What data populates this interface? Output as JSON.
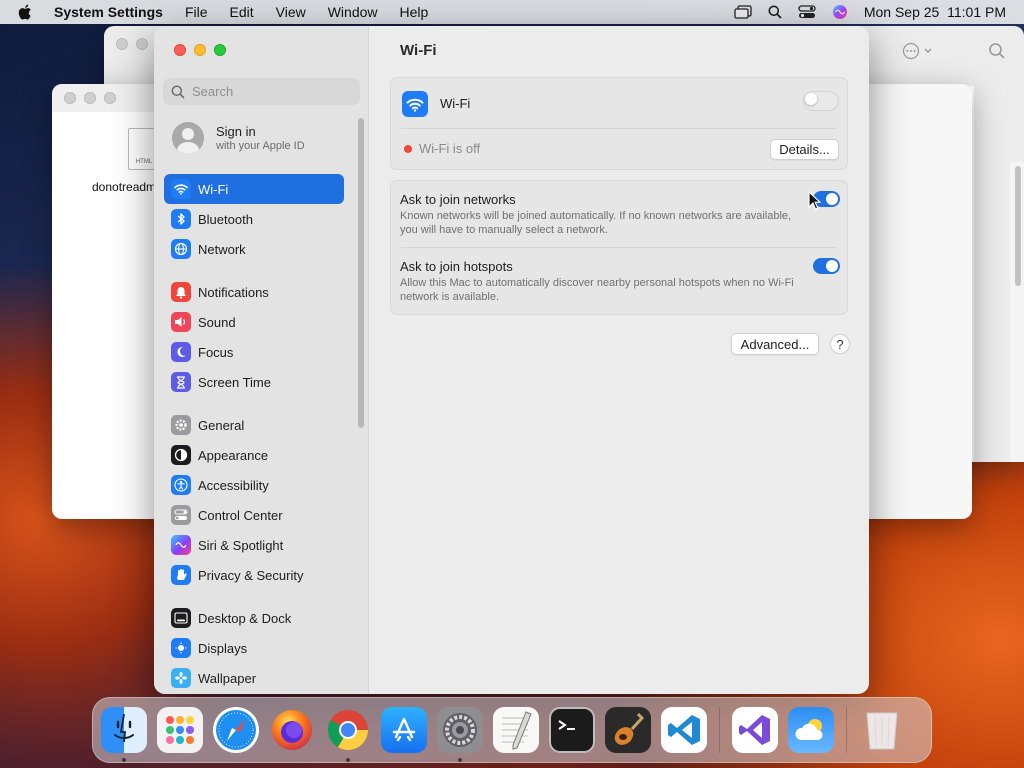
{
  "menubar": {
    "app_name": "System Settings",
    "menus": [
      "File",
      "Edit",
      "View",
      "Window",
      "Help"
    ],
    "clock": "Mon Sep 25  11:01 PM"
  },
  "background_window": {
    "file_label": "donotreadme",
    "file_type": "HTML"
  },
  "sidebar": {
    "search_placeholder": "Search",
    "signin_title": "Sign in",
    "signin_subtitle": "with your Apple ID",
    "groups": [
      [
        {
          "label": "Wi-Fi",
          "icon": "wifi-icon",
          "color": "#1f7cf5",
          "active": true
        },
        {
          "label": "Bluetooth",
          "icon": "bluetooth-icon",
          "color": "#1f7cf5"
        },
        {
          "label": "Network",
          "icon": "globe-icon",
          "color": "#1f7cf5"
        }
      ],
      [
        {
          "label": "Notifications",
          "icon": "bell-icon",
          "color": "#f0463c"
        },
        {
          "label": "Sound",
          "icon": "speaker-icon",
          "color": "#f0465a"
        },
        {
          "label": "Focus",
          "icon": "moon-icon",
          "color": "#5e5ce6"
        },
        {
          "label": "Screen Time",
          "icon": "hourglass-icon",
          "color": "#5e5ce6"
        }
      ],
      [
        {
          "label": "General",
          "icon": "gear-icon",
          "color": "#9a9a9f"
        },
        {
          "label": "Appearance",
          "icon": "appearance-icon",
          "color": "#1c1c1e"
        },
        {
          "label": "Accessibility",
          "icon": "accessibility-icon",
          "color": "#1f7cf5"
        },
        {
          "label": "Control Center",
          "icon": "control-center-icon",
          "color": "#9a9a9f"
        },
        {
          "label": "Siri & Spotlight",
          "icon": "siri-icon",
          "color": "#8a3ffc"
        },
        {
          "label": "Privacy & Security",
          "icon": "hand-icon",
          "color": "#1f7cf5"
        }
      ],
      [
        {
          "label": "Desktop & Dock",
          "icon": "dock-icon",
          "color": "#1c1c1e"
        },
        {
          "label": "Displays",
          "icon": "display-icon",
          "color": "#1f7cf5"
        },
        {
          "label": "Wallpaper",
          "icon": "wallpaper-icon",
          "color": "#3ab0f0"
        }
      ]
    ]
  },
  "main": {
    "title": "Wi-Fi",
    "wifi_label": "Wi-Fi",
    "wifi_enabled": false,
    "status_text": "Wi-Fi is off",
    "status_color": "#f0463c",
    "details_button": "Details...",
    "ask_networks_title": "Ask to join networks",
    "ask_networks_desc": "Known networks will be joined automatically. If no known networks are available, you will have to manually select a network.",
    "ask_networks_enabled": true,
    "ask_hotspots_title": "Ask to join hotspots",
    "ask_hotspots_desc": "Allow this Mac to automatically discover nearby personal hotspots when no Wi-Fi network is available.",
    "ask_hotspots_enabled": true,
    "advanced_button": "Advanced...",
    "help_button": "?"
  },
  "dock": {
    "apps": [
      {
        "name": "finder-icon",
        "running": true
      },
      {
        "name": "launchpad-icon",
        "running": false
      },
      {
        "name": "safari-icon",
        "running": false
      },
      {
        "name": "firefox-icon",
        "running": false
      },
      {
        "name": "chrome-icon",
        "running": true
      },
      {
        "name": "app-store-icon",
        "running": false
      },
      {
        "name": "system-settings-icon",
        "running": true
      },
      {
        "name": "textedit-icon",
        "running": false
      },
      {
        "name": "terminal-icon",
        "running": false
      },
      {
        "name": "garageband-icon",
        "running": false
      },
      {
        "name": "vscode-icon",
        "running": false
      }
    ],
    "recent_apps": [
      {
        "name": "visual-studio-icon"
      },
      {
        "name": "weather-icon"
      }
    ],
    "trash": "trash-icon"
  }
}
